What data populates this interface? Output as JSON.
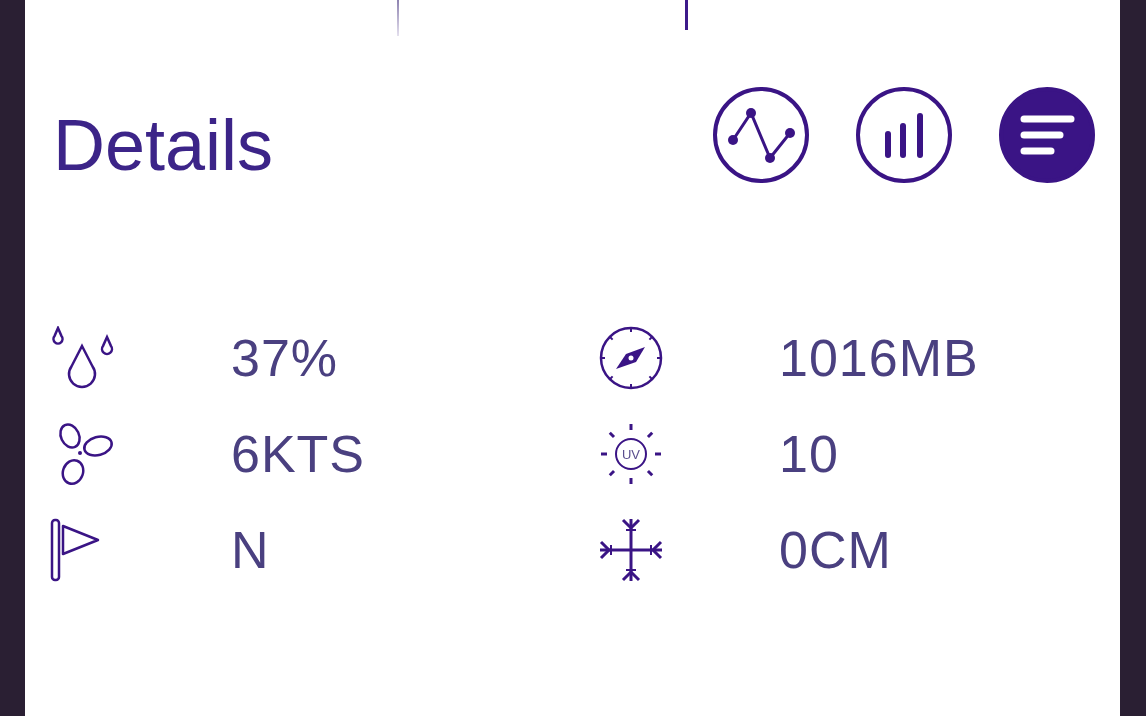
{
  "header": {
    "title": "Details"
  },
  "view_buttons": [
    {
      "kind": "line_chart",
      "selected": false
    },
    {
      "kind": "bar_chart",
      "selected": false
    },
    {
      "kind": "list",
      "selected": true
    }
  ],
  "details": [
    {
      "kind": "humidity",
      "value": "37%"
    },
    {
      "kind": "pressure",
      "value": "1016MB"
    },
    {
      "kind": "wind_speed",
      "value": "6KTS"
    },
    {
      "kind": "uv_index",
      "value": "10",
      "icon_label": "UV"
    },
    {
      "kind": "wind_direction",
      "value": "N"
    },
    {
      "kind": "snow",
      "value": "0CM"
    }
  ]
}
